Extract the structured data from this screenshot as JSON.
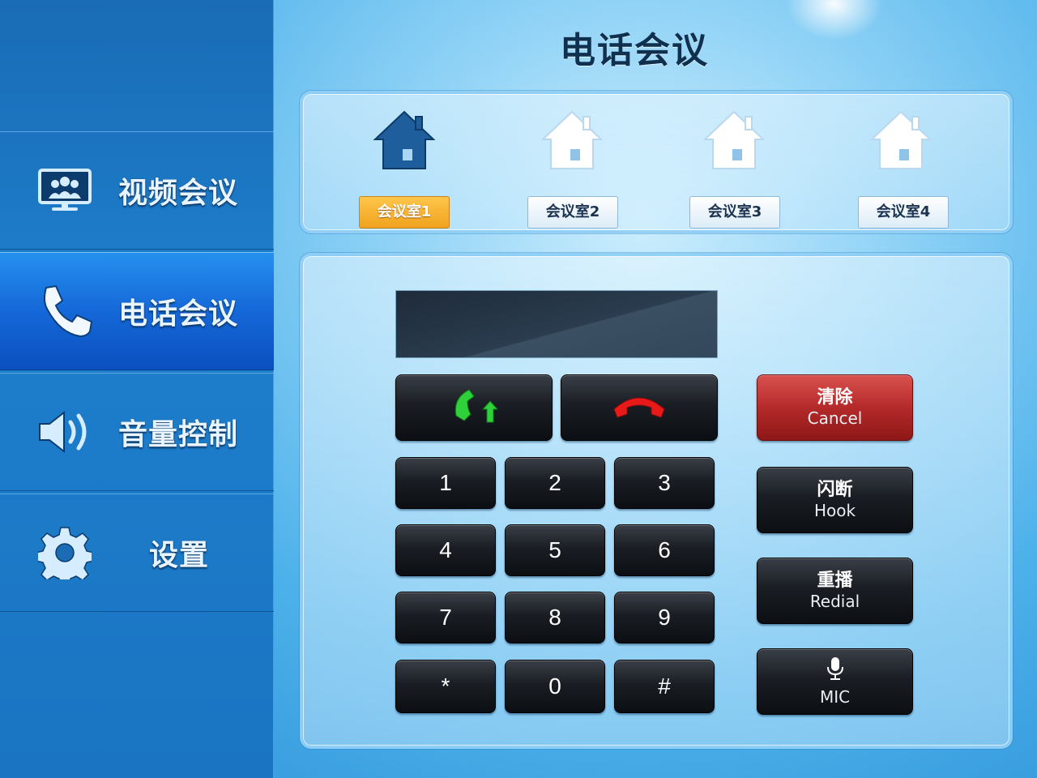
{
  "sidebar": {
    "items": [
      {
        "label": "视频会议",
        "icon": "monitor-people-icon",
        "active": false
      },
      {
        "label": "电话会议",
        "icon": "phone-icon",
        "active": true
      },
      {
        "label": "音量控制",
        "icon": "speaker-icon",
        "active": false
      },
      {
        "label": "设置",
        "icon": "gear-icon",
        "active": false
      }
    ]
  },
  "header": {
    "title": "电话会议"
  },
  "rooms": {
    "items": [
      {
        "label": "会议室1",
        "icon": "house-icon",
        "selected": true
      },
      {
        "label": "会议室2",
        "icon": "house-icon",
        "selected": false
      },
      {
        "label": "会议室3",
        "icon": "house-icon",
        "selected": false
      },
      {
        "label": "会议室4",
        "icon": "house-icon",
        "selected": false
      }
    ]
  },
  "dialer": {
    "display_value": "",
    "call_icon": "call-answer-icon",
    "hangup_icon": "hang-up-icon",
    "keys": [
      "1",
      "2",
      "3",
      "4",
      "5",
      "6",
      "7",
      "8",
      "9",
      "*",
      "0",
      "#"
    ],
    "clear": {
      "label_cn": "清除",
      "label_en": "Cancel"
    },
    "hook": {
      "label_cn": "闪断",
      "label_en": "Hook"
    },
    "redial": {
      "label_cn": "重播",
      "label_en": "Redial"
    },
    "mic": {
      "label_en": "MIC",
      "icon": "microphone-icon"
    }
  },
  "colors": {
    "accent_active": "#1568d8",
    "room_selected": "#f0a21e",
    "clear_button": "#b42a2a",
    "call_green": "#2fd13a",
    "hangup_red": "#e81919"
  }
}
